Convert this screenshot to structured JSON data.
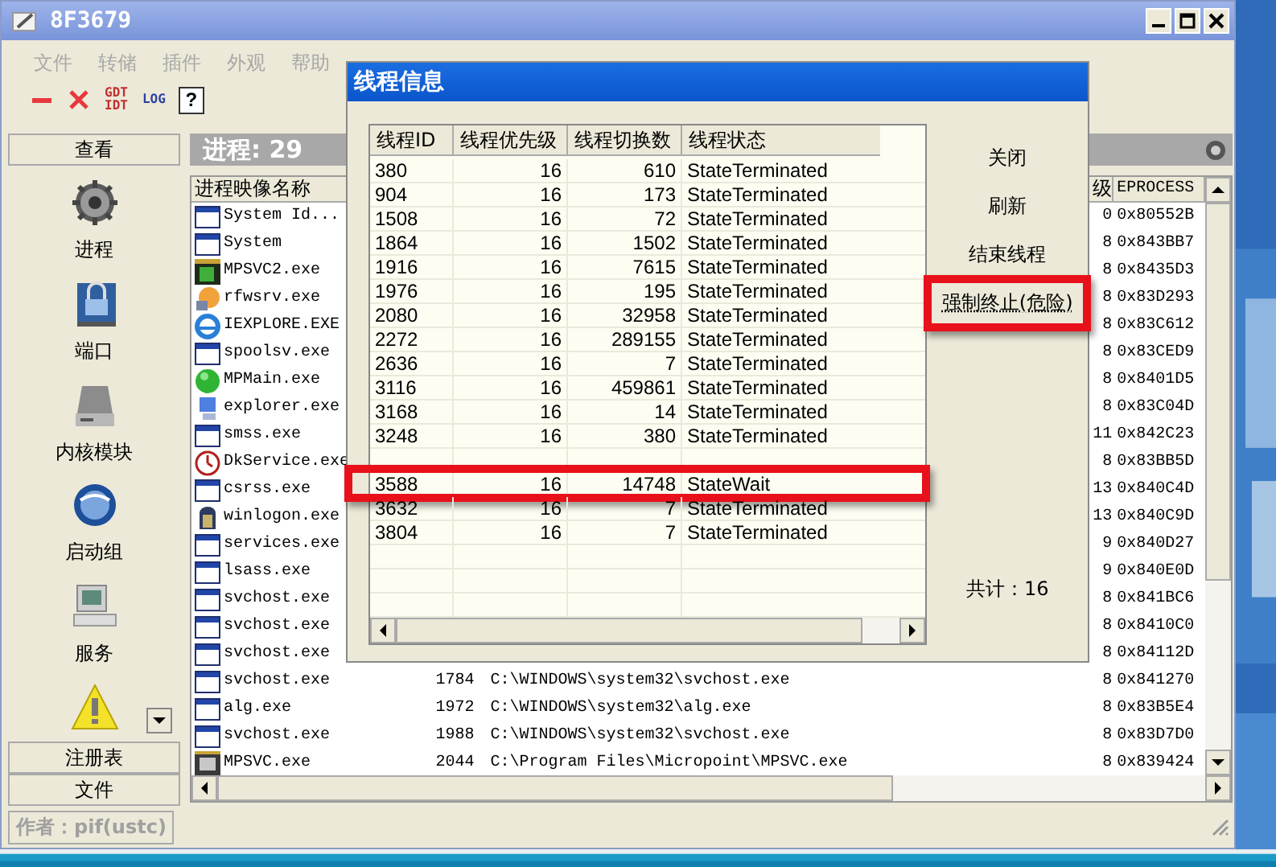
{
  "window": {
    "title": "8F3679"
  },
  "menu": [
    {
      "label": "文件",
      "disabled": true
    },
    {
      "label": "转储",
      "disabled": true
    },
    {
      "label": "插件",
      "disabled": true
    },
    {
      "label": "外观",
      "disabled": true
    },
    {
      "label": "帮助",
      "disabled": true
    }
  ],
  "toolbar": [
    {
      "kind": "minus"
    },
    {
      "kind": "cross"
    },
    {
      "kind": "text",
      "lines": [
        "GDT",
        "IDT"
      ]
    },
    {
      "kind": "text",
      "lines": [
        "LOG"
      ]
    },
    {
      "kind": "help",
      "text": "?"
    }
  ],
  "sidebar": {
    "header": "查看",
    "items": [
      {
        "kind": "gear",
        "label": "进程"
      },
      {
        "kind": "lock",
        "label": "端口"
      },
      {
        "kind": "drive",
        "label": "内核模块"
      },
      {
        "kind": "globe",
        "label": "启动组"
      },
      {
        "kind": "computer",
        "label": "服务"
      },
      {
        "kind": "warning"
      }
    ],
    "tabs": [
      "注册表",
      "文件"
    ]
  },
  "panel": {
    "title": "进程: 29"
  },
  "table": {
    "headers": {
      "image_name": "进程映像名称",
      "column_4": "级",
      "eprocess": "EPROCESS"
    },
    "rows": [
      {
        "kind": "window",
        "image_name": "System Id...",
        "column_4": "0",
        "eprocess": "0x80552B"
      },
      {
        "kind": "window",
        "image_name": "System",
        "column_4": "8",
        "eprocess": "0x843BB7"
      },
      {
        "kind": "app",
        "image_name": "MPSVC2.exe",
        "column_4": "8",
        "eprocess": "0x8435D3"
      },
      {
        "kind": "orb",
        "image_name": "rfwsrv.exe",
        "column_4": "8",
        "eprocess": "0x83D293"
      },
      {
        "kind": "browser",
        "image_name": "IEXPLORE.EXE",
        "column_4": "8",
        "eprocess": "0x83C612"
      },
      {
        "kind": "window",
        "image_name": "spoolsv.exe",
        "column_4": "8",
        "eprocess": "0x83CED9"
      },
      {
        "kind": "ball",
        "image_name": "MPMain.exe",
        "column_4": "8",
        "eprocess": "0x8401D5"
      },
      {
        "kind": "computer",
        "image_name": "explorer.exe",
        "column_4": "8",
        "eprocess": "0x83C04D"
      },
      {
        "kind": "window",
        "image_name": "smss.exe",
        "column_4": "11",
        "eprocess": "0x842C23"
      },
      {
        "kind": "clock",
        "image_name": "DkService.exe",
        "column_4": "8",
        "eprocess": "0x83BB5D"
      },
      {
        "kind": "window",
        "image_name": "csrss.exe",
        "column_4": "13",
        "eprocess": "0x840C4D"
      },
      {
        "kind": "door",
        "image_name": "winlogon.exe",
        "column_4": "13",
        "eprocess": "0x840C9D"
      },
      {
        "kind": "window",
        "image_name": "services.exe",
        "column_4": "9",
        "eprocess": "0x840D27"
      },
      {
        "kind": "window",
        "image_name": "lsass.exe",
        "column_4": "9",
        "eprocess": "0x840E0D"
      },
      {
        "kind": "window",
        "image_name": "svchost.exe",
        "column_4": "8",
        "eprocess": "0x841BC6"
      },
      {
        "kind": "window",
        "image_name": "svchost.exe",
        "column_4": "8",
        "eprocess": "0x8410C0"
      },
      {
        "kind": "window",
        "image_name": "svchost.exe",
        "column_4": "8",
        "eprocess": "0x84112D"
      },
      {
        "kind": "window",
        "image_name": "svchost.exe",
        "column_2": "1784",
        "column_3": "C:\\WINDOWS\\system32\\svchost.exe",
        "column_4": "8",
        "eprocess": "0x841270"
      },
      {
        "kind": "window",
        "image_name": "alg.exe",
        "column_2": "1972",
        "column_3": "C:\\WINDOWS\\system32\\alg.exe",
        "column_4": "8",
        "eprocess": "0x83B5E4"
      },
      {
        "kind": "window",
        "image_name": "svchost.exe",
        "column_2": "1988",
        "column_3": "C:\\WINDOWS\\system32\\svchost.exe",
        "column_4": "8",
        "eprocess": "0x83D7D0"
      },
      {
        "kind": "film",
        "image_name": "MPSVC.exe",
        "column_2": "2044",
        "column_3": "C:\\Program Files\\Micropoint\\MPSVC.exe",
        "column_4": "8",
        "eprocess": "0x839424"
      }
    ]
  },
  "status_bar": {
    "text": "作者：pif(ustc)"
  },
  "dialog": {
    "title": "线程信息",
    "columns": [
      "线程ID",
      "线程优先级",
      "线程切换数",
      "线程状态"
    ],
    "rows": [
      {
        "kind": "row",
        "id": "380",
        "priority": "16",
        "switches": "610",
        "state": "StateTerminated",
        "highlighted": false
      },
      {
        "kind": "row",
        "id": "904",
        "priority": "16",
        "switches": "173",
        "state": "StateTerminated",
        "highlighted": false
      },
      {
        "kind": "row",
        "id": "1508",
        "priority": "16",
        "switches": "72",
        "state": "StateTerminated",
        "highlighted": false
      },
      {
        "kind": "row",
        "id": "1864",
        "priority": "16",
        "switches": "1502",
        "state": "StateTerminated",
        "highlighted": false
      },
      {
        "kind": "row",
        "id": "1916",
        "priority": "16",
        "switches": "7615",
        "state": "StateTerminated",
        "highlighted": false
      },
      {
        "kind": "row",
        "id": "1976",
        "priority": "16",
        "switches": "195",
        "state": "StateTerminated",
        "highlighted": false
      },
      {
        "kind": "row",
        "id": "2080",
        "priority": "16",
        "switches": "32958",
        "state": "StateTerminated",
        "highlighted": false
      },
      {
        "kind": "row",
        "id": "2272",
        "priority": "16",
        "switches": "289155",
        "state": "StateTerminated",
        "highlighted": false
      },
      {
        "kind": "row",
        "id": "2636",
        "priority": "16",
        "switches": "7",
        "state": "StateTerminated",
        "highlighted": false
      },
      {
        "kind": "row",
        "id": "3116",
        "priority": "16",
        "switches": "459861",
        "state": "StateTerminated",
        "highlighted": false
      },
      {
        "kind": "row",
        "id": "3168",
        "priority": "16",
        "switches": "14",
        "state": "StateTerminated",
        "highlighted": false
      },
      {
        "kind": "row",
        "id": "3248",
        "priority": "16",
        "switches": "380",
        "state": "StateTerminated",
        "highlighted": false
      },
      {
        "kind": "covered"
      },
      {
        "kind": "row",
        "id": "3588",
        "priority": "16",
        "switches": "14748",
        "state": "StateWait",
        "highlighted": true
      },
      {
        "kind": "row",
        "id": "3632",
        "priority": "16",
        "switches": "7",
        "state": "StateTerminated",
        "highlighted": false
      },
      {
        "kind": "row",
        "id": "3804",
        "priority": "16",
        "switches": "7",
        "state": "StateTerminated",
        "highlighted": false
      }
    ],
    "buttons": [
      {
        "label": "关闭",
        "highlighted": false
      },
      {
        "label": "刷新",
        "highlighted": false
      },
      {
        "label": "结束线程",
        "highlighted": false
      },
      {
        "label": "强制终止(危险)",
        "highlighted": true
      }
    ],
    "total": "共计：16"
  }
}
